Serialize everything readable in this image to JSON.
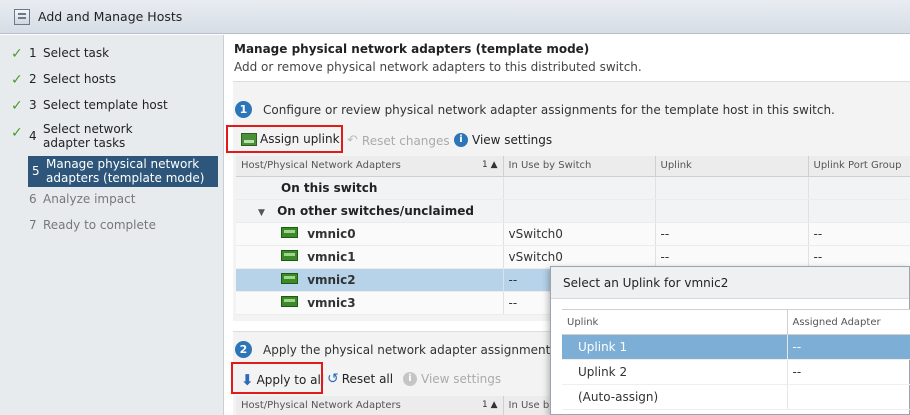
{
  "window": {
    "title": "Add and Manage Hosts"
  },
  "steps": [
    {
      "num": "1",
      "label": "Select task",
      "state": "done"
    },
    {
      "num": "2",
      "label": "Select hosts",
      "state": "done"
    },
    {
      "num": "3",
      "label": "Select template host",
      "state": "done"
    },
    {
      "num": "4",
      "label": "Select network adapter tasks",
      "state": "done"
    },
    {
      "num": "5",
      "label": "Manage physical network adapters (template mode)",
      "state": "active"
    },
    {
      "num": "6",
      "label": "Analyze impact",
      "state": "pending"
    },
    {
      "num": "7",
      "label": "Ready to complete",
      "state": "pending"
    }
  ],
  "header": {
    "title": "Manage physical network adapters (template mode)",
    "subtitle": "Add or remove physical network adapters to this distributed switch."
  },
  "section1": {
    "badge": "1",
    "text": "Configure or review physical network adapter assignments for the template host in this switch.",
    "toolbar": {
      "assign_uplink": "Assign uplink",
      "reset_changes": "Reset changes",
      "view_settings": "View settings"
    },
    "table": {
      "columns": [
        "Host/Physical Network Adapters",
        "In Use by Switch",
        "Uplink",
        "Uplink Port Group"
      ],
      "sort_indicator": "1 ▲",
      "groups": {
        "on_this_switch": "On this switch",
        "on_other": "On other switches/unclaimed"
      },
      "rows": [
        {
          "name": "vmnic0",
          "in_use": "vSwitch0",
          "uplink": "--",
          "port_group": "--"
        },
        {
          "name": "vmnic1",
          "in_use": "vSwitch0",
          "uplink": "--",
          "port_group": "--"
        },
        {
          "name": "vmnic2",
          "in_use": "--",
          "uplink": "",
          "port_group": ""
        },
        {
          "name": "vmnic3",
          "in_use": "--",
          "uplink": "",
          "port_group": ""
        }
      ]
    }
  },
  "section2": {
    "badge": "2",
    "text": "Apply the physical network adapter assignments on t",
    "toolbar": {
      "apply_to_all": "Apply to all",
      "reset_all": "Reset all",
      "view_settings": "View settings"
    },
    "table": {
      "columns": [
        "Host/Physical Network Adapters",
        "In Use b"
      ],
      "sort_indicator": "1 ▲"
    }
  },
  "popup": {
    "title": "Select an Uplink for vmnic2",
    "columns": [
      "Uplink",
      "Assigned Adapter"
    ],
    "rows": [
      {
        "uplink": "Uplink 1",
        "assigned": "--"
      },
      {
        "uplink": "Uplink 2",
        "assigned": "--"
      },
      {
        "uplink": "(Auto-assign)",
        "assigned": ""
      }
    ]
  },
  "colors": {
    "accent": "#2b75b8",
    "active_step": "#2d567a",
    "selected_row": "#b6d3ea",
    "popup_selected": "#7daed5",
    "highlight_box": "#e01b1b"
  }
}
